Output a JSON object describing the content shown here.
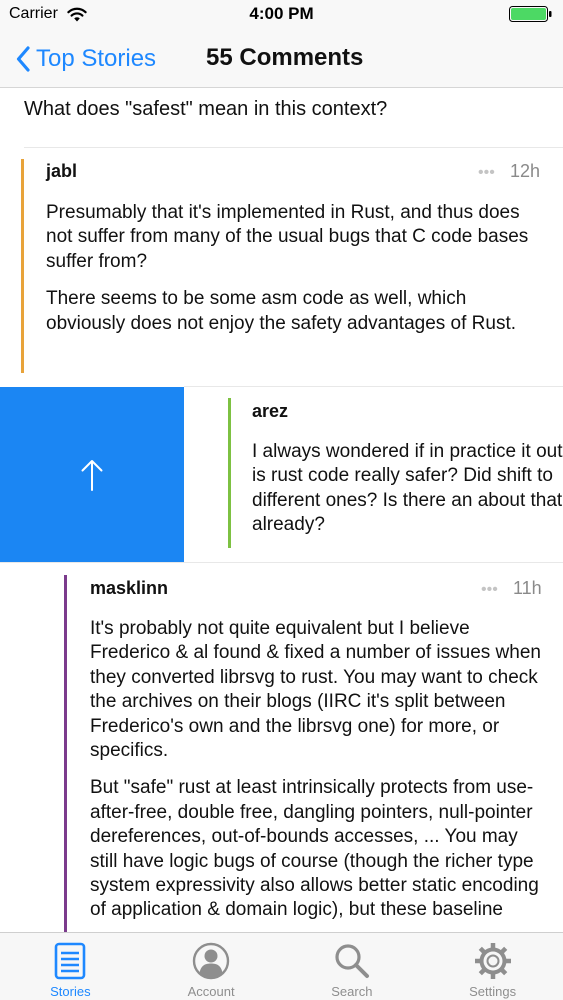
{
  "status_bar": {
    "carrier": "Carrier",
    "time": "4:00 PM"
  },
  "nav": {
    "back_label": "Top Stories",
    "title": "55 Comments"
  },
  "parent_comment": {
    "text": "What does \"safest\" mean in this context?"
  },
  "comments": [
    {
      "author": "jabl",
      "age": "12h",
      "dots": "•••",
      "bar_color": "#e8a33a",
      "paragraphs": [
        "Presumably that it's implemented in Rust, and thus does not suffer from many of the usual bugs that C code bases suffer from?",
        "There seems to be some asm code as well, which obviously does not enjoy the safety advantages of Rust."
      ]
    },
    {
      "author": "arez",
      "bar_color": "#7dc142",
      "paragraphs": [
        "I always wondered if in practice it out, is rust code really safer? Did shift to different ones? Is there an about that already?"
      ]
    },
    {
      "author": "masklinn",
      "age": "11h",
      "dots": "•••",
      "bar_color": "#7b3b8c",
      "paragraphs": [
        "It's probably not quite equivalent but I believe Frederico & al found & fixed a number of issues when they converted librsvg to rust. You may want to check the archives on their blogs (IIRC it's split between Frederico's own and the librsvg one) for more, or specifics.",
        "But \"safe\" rust at least intrinsically protects from use-after-free, double free, dangling pointers, null-pointer dereferences, out-of-bounds accesses, ... You may still have logic bugs of course (though the richer type system expressivity also allows better static encoding of application & domain logic), but these baseline"
      ]
    }
  ],
  "swipe_action": {
    "icon": "arrow-up-icon",
    "color": "#1b86f3"
  },
  "tabs": [
    {
      "label": "Stories",
      "icon": "stories-icon",
      "active": true
    },
    {
      "label": "Account",
      "icon": "account-icon",
      "active": false
    },
    {
      "label": "Search",
      "icon": "search-icon",
      "active": false
    },
    {
      "label": "Settings",
      "icon": "gear-icon",
      "active": false
    }
  ],
  "colors": {
    "accent": "#1e88ff",
    "battery": "#4cd964"
  }
}
